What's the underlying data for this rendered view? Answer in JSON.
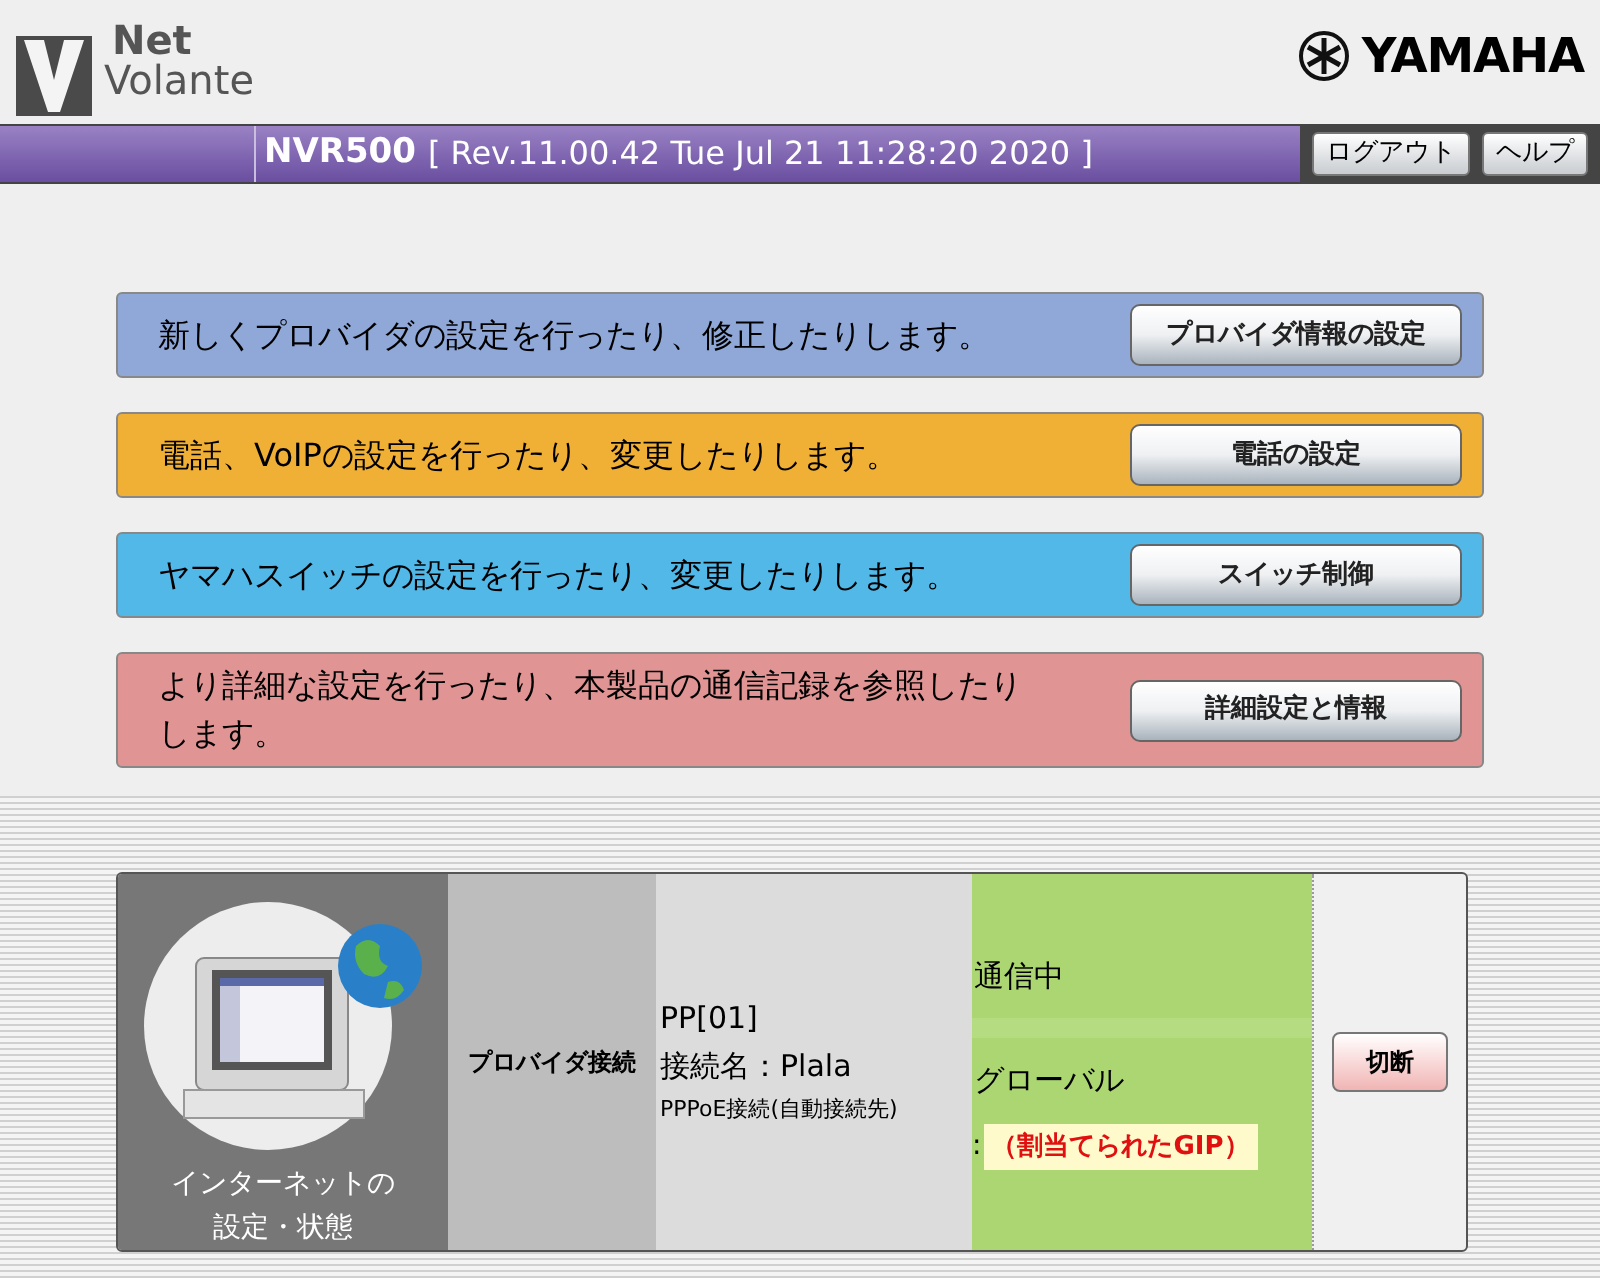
{
  "header": {
    "logo_top": "Net",
    "logo_bottom": "Volante",
    "brand": "YAMAHA"
  },
  "title_bar": {
    "model": "NVR500",
    "revision": "[ Rev.11.00.42 Tue Jul 21 11:28:20 2020 ]",
    "buttons": [
      "ログアウト",
      "ヘルプ"
    ]
  },
  "menu": [
    {
      "text": "新しくプロバイダの設定を行ったり、修正したりします。",
      "button": "プロバイダ情報の設定",
      "color": "#8fa8d8"
    },
    {
      "text": "電話、VoIPの設定を行ったり、変更したりします。",
      "button": "電話の設定",
      "color": "#f0b036"
    },
    {
      "text": "ヤマハスイッチの設定を行ったり、変更したりします。",
      "button": "スイッチ制御",
      "color": "#52b8e8"
    },
    {
      "text": "より詳細な設定を行ったり、本製品の通信記録を参照したりします。",
      "button": "詳細設定と情報",
      "color": "#e09494"
    }
  ],
  "status_panel": {
    "label": "インターネットの設定・状態",
    "connection_type": "プロバイダ接続",
    "interface": "PP[01]",
    "connection_name": "接続名：Plala",
    "method": "PPPoE接続(自動接続先)",
    "state": "通信中",
    "address_type": "グローバル",
    "address_prefix": ":",
    "address": "（割当てられたGIP）",
    "button": "切断"
  }
}
